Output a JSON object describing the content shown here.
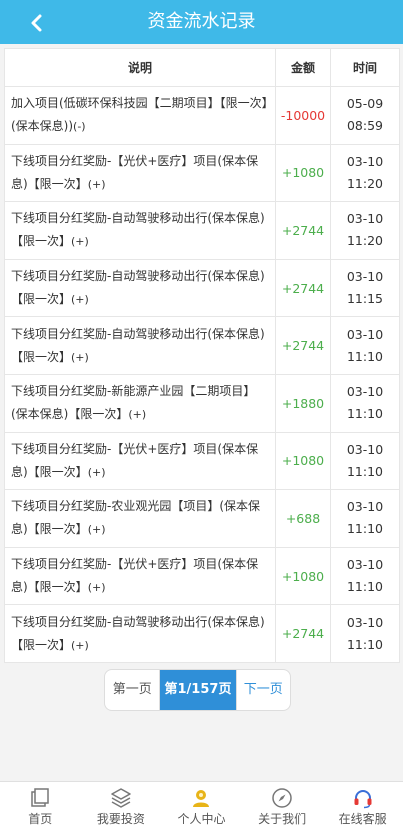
{
  "header": {
    "title": "资金流水记录"
  },
  "table": {
    "columns": [
      "说明",
      "金额",
      "时间"
    ],
    "rows": [
      {
        "desc": "加入项目(低碳环保科技园【二期项目】【限一次】(保本保息))",
        "tag": "(-)",
        "amount": "-10000",
        "date": "05-09",
        "time": "08:59",
        "sign": "neg"
      },
      {
        "desc": "下线项目分红奖励-【光伏+医疗】项目(保本保息)【限一次】",
        "tag": "(+)",
        "amount": "+1080",
        "date": "03-10",
        "time": "11:20",
        "sign": "pos"
      },
      {
        "desc": "下线项目分红奖励-自动驾驶移动出行(保本保息)【限一次】",
        "tag": "(+)",
        "amount": "+2744",
        "date": "03-10",
        "time": "11:20",
        "sign": "pos"
      },
      {
        "desc": "下线项目分红奖励-自动驾驶移动出行(保本保息)【限一次】",
        "tag": "(+)",
        "amount": "+2744",
        "date": "03-10",
        "time": "11:15",
        "sign": "pos"
      },
      {
        "desc": "下线项目分红奖励-自动驾驶移动出行(保本保息)【限一次】",
        "tag": "(+)",
        "amount": "+2744",
        "date": "03-10",
        "time": "11:10",
        "sign": "pos"
      },
      {
        "desc": "下线项目分红奖励-新能源产业园【二期项目】(保本保息)【限一次】",
        "tag": "(+)",
        "amount": "+1880",
        "date": "03-10",
        "time": "11:10",
        "sign": "pos"
      },
      {
        "desc": "下线项目分红奖励-【光伏+医疗】项目(保本保息)【限一次】",
        "tag": "(+)",
        "amount": "+1080",
        "date": "03-10",
        "time": "11:10",
        "sign": "pos"
      },
      {
        "desc": "下线项目分红奖励-农业观光园【项目】(保本保息)【限一次】",
        "tag": "(+)",
        "amount": "+688",
        "date": "03-10",
        "time": "11:10",
        "sign": "pos"
      },
      {
        "desc": "下线项目分红奖励-【光伏+医疗】项目(保本保息)【限一次】",
        "tag": "(+)",
        "amount": "+1080",
        "date": "03-10",
        "time": "11:10",
        "sign": "pos"
      },
      {
        "desc": "下线项目分红奖励-自动驾驶移动出行(保本保息)【限一次】",
        "tag": "(+)",
        "amount": "+2744",
        "date": "03-10",
        "time": "11:10",
        "sign": "pos"
      }
    ]
  },
  "pager": {
    "prev": "第一页",
    "current": "第1/157页",
    "next": "下一页"
  },
  "tabbar": [
    {
      "label": "首页",
      "icon": "home-icon"
    },
    {
      "label": "我要投资",
      "icon": "layers-icon"
    },
    {
      "label": "个人中心",
      "icon": "user-icon"
    },
    {
      "label": "关于我们",
      "icon": "compass-icon"
    },
    {
      "label": "在线客服",
      "icon": "headset-icon"
    }
  ],
  "colors": {
    "header": "#3fb9e8",
    "positive": "#4cae4c",
    "negative": "#e53935",
    "pager_active": "#2f8fd8"
  }
}
